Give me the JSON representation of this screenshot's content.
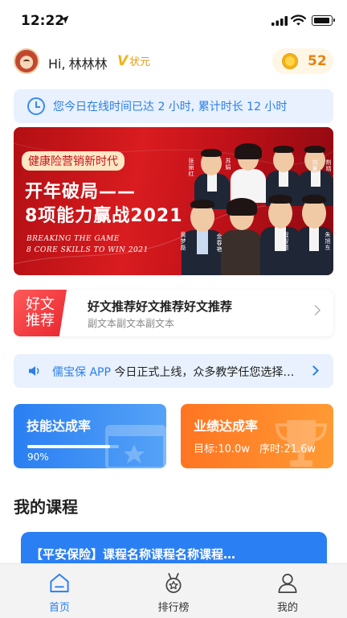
{
  "status_bar": {
    "time": "12:22"
  },
  "header": {
    "greeting": "Hi,",
    "username": "林林林",
    "vip_label": "状元",
    "coins": "52"
  },
  "notice": {
    "text": "您今日在线时间已达 2 小时, 累计时长 12 小时"
  },
  "banner": {
    "pill": "健康险营销新时代",
    "title_line1": "开年破局——",
    "title_line2": "8项能力赢战2021",
    "en_line1": "BREAKING THE GAME",
    "en_line2": "8 CORE SKILLS TO WIN 2021",
    "people": [
      "张丽红",
      "苏娟",
      "刘夏",
      "荆晴",
      "黄梦磊",
      "金春艳",
      "程智德",
      "朱旭东"
    ]
  },
  "article": {
    "badge_line1": "好文",
    "badge_line2": "推荐",
    "title": "好文推荐好文推荐好文推荐",
    "subtitle": "副文本副文本副文本"
  },
  "announcement": {
    "brand": "儒宝保 APP",
    "text": "今日正式上线，众多教学任您选择…"
  },
  "skill_card": {
    "title": "技能达成率",
    "progress": 0.9,
    "progress_label": "90%"
  },
  "performance_card": {
    "title": "业绩达成率",
    "target": "目标:10.0w",
    "timeline": "序时:21.6w"
  },
  "section": {
    "title": "我的课程"
  },
  "course": {
    "title": "【平安保险】课程名称课程名称课程…"
  },
  "tabbar": {
    "tabs": [
      {
        "label": "首页"
      },
      {
        "label": "排行榜"
      },
      {
        "label": "我的"
      }
    ]
  },
  "colors": {
    "primary": "#2a7ff2",
    "orange": "#ff7f26",
    "banner_red": "#d91c1f",
    "coin": "#e8820f"
  }
}
